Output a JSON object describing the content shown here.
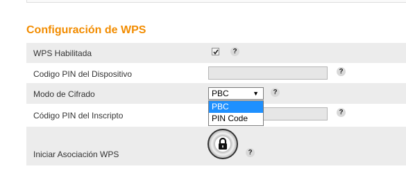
{
  "section_title": "Configuración de WPS",
  "rows": {
    "wps_enabled": {
      "label": "WPS Habilitada",
      "checked": true
    },
    "device_pin": {
      "label": "Codigo PIN del Dispositivo",
      "value": ""
    },
    "encryption_mode": {
      "label": "Modo de Cifrado",
      "selected": "PBC",
      "options": [
        "PBC",
        "PIN Code"
      ]
    },
    "enrollee_pin": {
      "label": "Código PIN del Inscripto",
      "value": ""
    },
    "start_wps": {
      "label": "Iniciar Asociación WPS"
    }
  },
  "help_glyph": "?",
  "icons": {
    "help": "help-icon",
    "lock": "lock-icon",
    "check": "checkmark-icon",
    "dropdown": "chevron-down-icon"
  },
  "colors": {
    "accent": "#f28c00",
    "row_alt": "#ececec",
    "selection": "#1e90ff"
  }
}
